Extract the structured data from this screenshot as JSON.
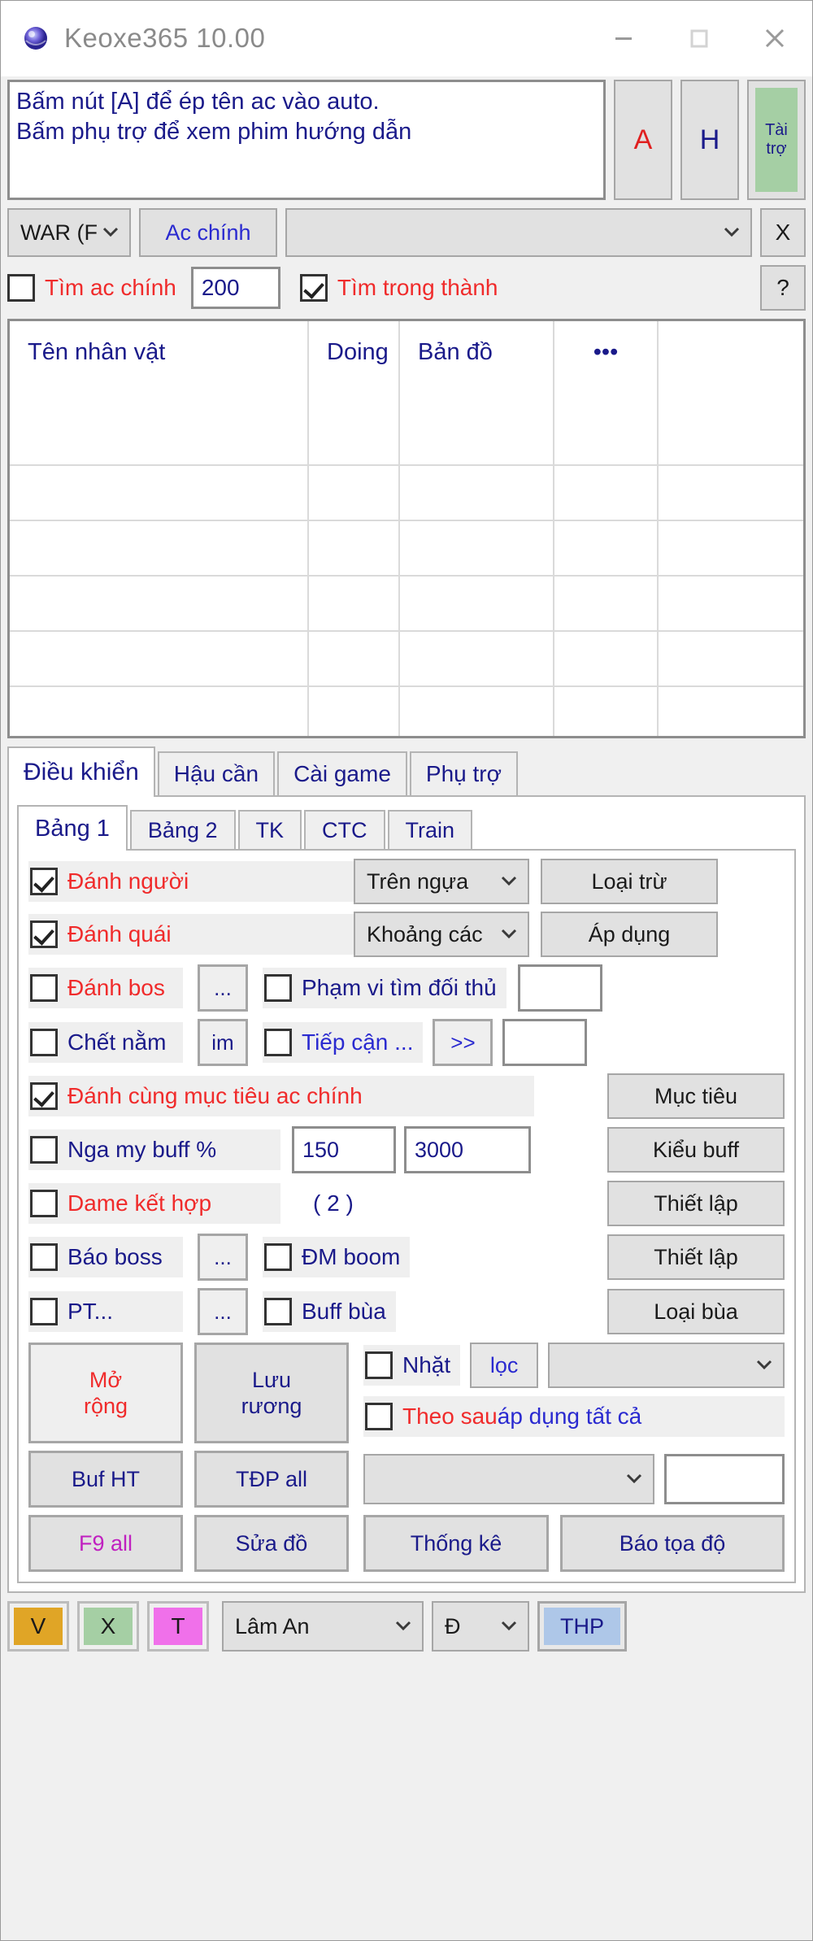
{
  "window": {
    "title": "Keoxe365 10.00",
    "icon": "app-globe-icon",
    "minimize": "minimize-icon",
    "maximize": "maximize-icon",
    "close": "close-icon"
  },
  "message": {
    "line1": "Bấm nút [A] để ép tên ac vào auto.",
    "line2": "Bấm phụ trợ để xem phim hướng dẫn"
  },
  "header_buttons": {
    "a": "A",
    "h": "H",
    "sponsor_line1": "Tài",
    "sponsor_line2": "trợ"
  },
  "select_row": {
    "server": "WAR (F",
    "main_account_button": "Ac chính",
    "char_select": "",
    "close_button": "X"
  },
  "search_row": {
    "find_main_label": "Tìm ac chính",
    "find_main_checked": false,
    "radius_value": "200",
    "find_in_town_label": "Tìm trong thành",
    "find_in_town_checked": true,
    "help_button": "?"
  },
  "grid": {
    "columns": [
      "Tên nhân vật",
      "Doing",
      "Bản đồ",
      "•••",
      ""
    ],
    "rows": []
  },
  "tabs": {
    "main": [
      {
        "label": "Điều khiển",
        "active": true
      },
      {
        "label": "Hậu cần",
        "active": false
      },
      {
        "label": "Cài game",
        "active": false
      },
      {
        "label": "Phụ trợ",
        "active": false
      }
    ],
    "sub": [
      {
        "label": "Bảng 1",
        "active": true
      },
      {
        "label": "Bảng 2",
        "active": false
      },
      {
        "label": "TK",
        "active": false
      },
      {
        "label": "CTC",
        "active": false
      },
      {
        "label": "Train",
        "active": false
      }
    ]
  },
  "controls": {
    "row1": {
      "check_label": "Đánh người",
      "checked": true,
      "combo": "Trên ngựa",
      "button": "Loại trừ"
    },
    "row2": {
      "check_label": "Đánh quái",
      "checked": true,
      "combo": "Khoảng các",
      "button": "Áp dụng"
    },
    "row3": {
      "check_label": "Đánh bos",
      "checked": false,
      "small_button": "...",
      "check2_label": "Phạm vi tìm đối thủ",
      "check2_checked": false,
      "text_value": ""
    },
    "row4": {
      "check_label": "Chết nằm",
      "checked": false,
      "small_button": "im",
      "check2_label": "Tiếp cận ...",
      "check2_checked": false,
      "arrow_button": ">>",
      "text_value": ""
    },
    "row5": {
      "check_label": "Đánh cùng mục tiêu ac chính",
      "checked": true,
      "button": "Mục tiêu"
    },
    "row6": {
      "check_label": "Nga my buff %",
      "checked": false,
      "value1": "150",
      "value2": "3000",
      "button": "Kiểu buff"
    },
    "row7": {
      "check_label": "Dame kết hợp",
      "checked": false,
      "count_label": "( 2 )",
      "button": "Thiết lập"
    },
    "row8": {
      "check_label": "Báo boss",
      "checked": false,
      "small_button": "...",
      "check2_label": "ĐM boom",
      "check2_checked": false,
      "button": "Thiết lập"
    },
    "row9": {
      "check_label": "PT...",
      "checked": false,
      "small_button": "...",
      "check2_label": "Buff bùa",
      "check2_checked": false,
      "button": "Loại bùa"
    },
    "row10": {
      "btn_expand_l1": "Mở",
      "btn_expand_l2": "rộng",
      "btn_save_l1": "Lưu",
      "btn_save_l2": "rương",
      "check_pickup_label": "Nhặt",
      "check_pickup_checked": false,
      "filter_button": "lọc",
      "filter_combo": "",
      "check_follow_label_1": "Theo sau ",
      "check_follow_label_2": "áp dụng tất cả",
      "check_follow_checked": false
    },
    "row11": {
      "btn_bufht": "Buf HT",
      "btn_tdpall": "TĐP all",
      "combo": "",
      "text_value": ""
    },
    "row12": {
      "btn_f9all": "F9 all",
      "btn_suado": "Sửa đồ",
      "btn_thongke": "Thống kê",
      "btn_baotoado": "Báo tọa độ"
    }
  },
  "statusbar": {
    "btn_v": "V",
    "btn_v_color": "#e0a526",
    "btn_x": "X",
    "btn_x_color": "#a5cfa4",
    "btn_t": "T",
    "btn_t_color": "#f070ea",
    "location_combo": "Lâm An",
    "dd_combo": "Đ",
    "btn_thp": "THP",
    "btn_thp_color": "#aec7e8"
  }
}
